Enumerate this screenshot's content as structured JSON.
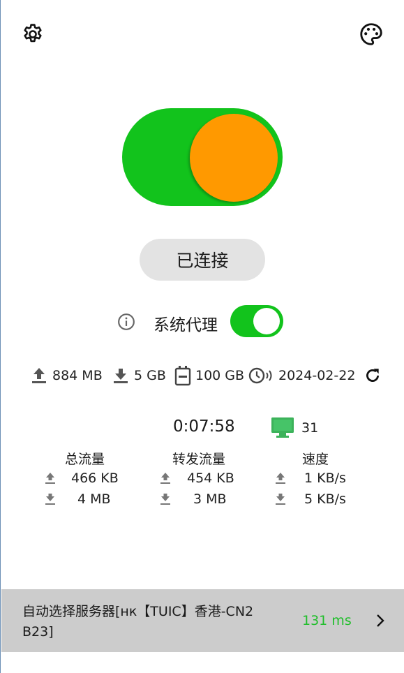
{
  "header": {
    "settings_icon": "gear-icon",
    "theme_icon": "palette-icon"
  },
  "main_toggle": {
    "state": "on",
    "track_color": "#12c31c",
    "knob_color": "#ff9900"
  },
  "status": {
    "label": "已连接"
  },
  "system_proxy": {
    "label": "系统代理",
    "enabled": true,
    "info_icon": "info-icon"
  },
  "usage": {
    "upload": "884 MB",
    "download": "5 GB",
    "total": "100 GB",
    "expiry": "2024-02-22"
  },
  "session": {
    "duration": "0:07:58",
    "connections": "31"
  },
  "traffic": {
    "total": {
      "title": "总流量",
      "up": "466 KB",
      "down": "4 MB"
    },
    "forwarded": {
      "title": "转发流量",
      "up": "454 KB",
      "down": "3 MB"
    },
    "speed": {
      "title": "速度",
      "up": "1 KB/s",
      "down": "5 KB/s"
    }
  },
  "server": {
    "name": "自动选择服务器[нк【TUIC】香港-CN2 B23]",
    "latency": "131 ms",
    "latency_color": "#1fbe2a"
  }
}
